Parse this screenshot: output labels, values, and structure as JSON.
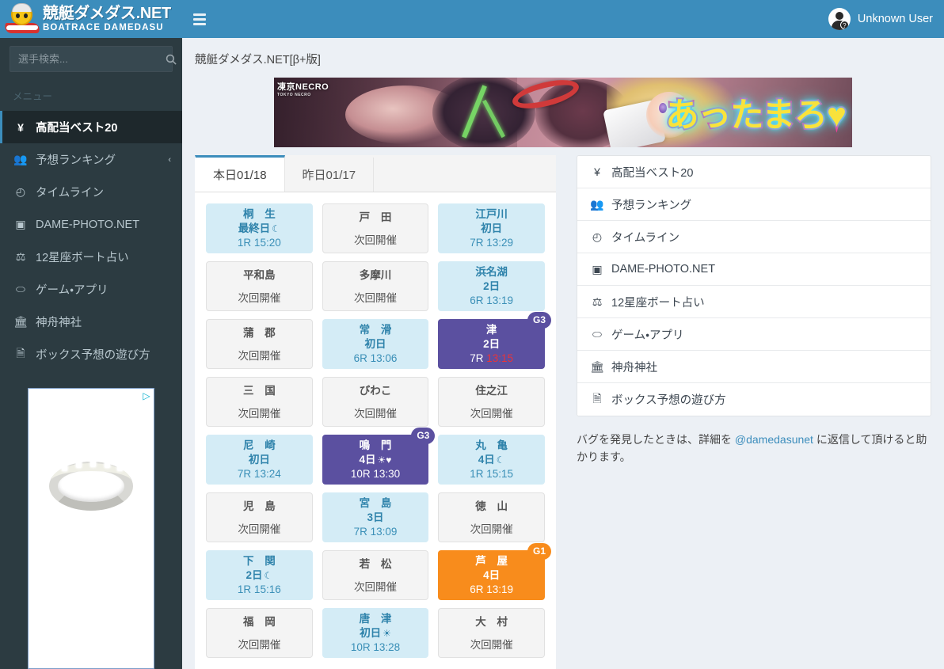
{
  "brand": {
    "title": "競艇ダメダス.NET",
    "subtitle": "BOATRACE DAMEDASU"
  },
  "search": {
    "placeholder": "選手検索...",
    "value": "",
    "icon": "search-icon"
  },
  "sidebar": {
    "menu_header": "メニュー",
    "items": [
      {
        "label": "高配当ベスト20",
        "icon": "¥",
        "icon_name": "yen-icon",
        "active": true,
        "caret": ""
      },
      {
        "label": "予想ランキング",
        "icon": "👥",
        "icon_name": "users-icon",
        "active": false,
        "caret": "‹"
      },
      {
        "label": "タイムライン",
        "icon": "◴",
        "icon_name": "clock-icon",
        "active": false,
        "caret": ""
      },
      {
        "label": "DAME-PHOTO.NET",
        "icon": "▣",
        "icon_name": "camera-icon",
        "active": false,
        "caret": ""
      },
      {
        "label": "12星座ボート占い",
        "icon": "⚖",
        "icon_name": "scales-icon",
        "active": false,
        "caret": ""
      },
      {
        "label": "ゲーム・アプリ",
        "icon": "⬭",
        "icon_name": "gamepad-icon",
        "active": false,
        "caret": ""
      },
      {
        "label": "神舟神社",
        "icon": "🏛",
        "icon_name": "bank-icon",
        "active": false,
        "caret": ""
      },
      {
        "label": "ボックス予想の遊び方",
        "icon": "🗎",
        "icon_name": "document-icon",
        "active": false,
        "caret": ""
      }
    ]
  },
  "ad": {
    "label": "▷",
    "alt": "diamond-ring-advertisement"
  },
  "topbar": {
    "menu_toggle": "hamburger-icon",
    "user_name": "Unknown User"
  },
  "page": {
    "title": "競艇ダメダス.NET[β+版]"
  },
  "banner": {
    "brand_logo": "凍京NECRO",
    "brand_sub": "TOKYO NECRO",
    "catch": "あったまろ♥"
  },
  "tabs": [
    {
      "label": "本日01/18",
      "active": true
    },
    {
      "label": "昨日01/17",
      "active": false
    }
  ],
  "races": [
    {
      "venue": "桐 生",
      "day": "最終日",
      "icon": "☾",
      "icon_name": "moon-icon",
      "race": "1R 15:20",
      "state": "lit",
      "grade": "",
      "time_red": false
    },
    {
      "venue": "戸 田",
      "day": "",
      "icon": "",
      "icon_name": "",
      "race": "次回開催",
      "state": "off",
      "grade": "",
      "time_red": false
    },
    {
      "venue": "江戸川",
      "day": "初日",
      "icon": "",
      "icon_name": "",
      "race": "7R 13:29",
      "state": "lit",
      "grade": "",
      "time_red": false
    },
    {
      "venue": "平和島",
      "day": "",
      "icon": "",
      "icon_name": "",
      "race": "次回開催",
      "state": "off",
      "grade": "",
      "time_red": false
    },
    {
      "venue": "多摩川",
      "day": "",
      "icon": "",
      "icon_name": "",
      "race": "次回開催",
      "state": "off",
      "grade": "",
      "time_red": false
    },
    {
      "venue": "浜名湖",
      "day": "2日",
      "icon": "",
      "icon_name": "",
      "race": "6R 13:19",
      "state": "lit",
      "grade": "",
      "time_red": false
    },
    {
      "venue": "蒲 郡",
      "day": "",
      "icon": "",
      "icon_name": "",
      "race": "次回開催",
      "state": "off",
      "grade": "",
      "time_red": false
    },
    {
      "venue": "常 滑",
      "day": "初日",
      "icon": "",
      "icon_name": "",
      "race": "6R 13:06",
      "state": "lit",
      "grade": "",
      "time_red": false
    },
    {
      "venue": "津",
      "day": "2日",
      "icon": "",
      "icon_name": "",
      "race": "7R",
      "race_time": "13:15",
      "state": "g3",
      "grade": "G3",
      "time_red": true
    },
    {
      "venue": "三 国",
      "day": "",
      "icon": "",
      "icon_name": "",
      "race": "次回開催",
      "state": "off",
      "grade": "",
      "time_red": false
    },
    {
      "venue": "びわこ",
      "day": "",
      "icon": "",
      "icon_name": "",
      "race": "次回開催",
      "state": "off",
      "grade": "",
      "time_red": false
    },
    {
      "venue": "住之江",
      "day": "",
      "icon": "",
      "icon_name": "",
      "race": "次回開催",
      "state": "off",
      "grade": "",
      "time_red": false
    },
    {
      "venue": "尼 崎",
      "day": "初日",
      "icon": "",
      "icon_name": "",
      "race": "7R 13:24",
      "state": "lit",
      "grade": "",
      "time_red": false
    },
    {
      "venue": "鳴 門",
      "day": "4日",
      "icon": "☀♥",
      "icon_name": "sun-heart-icon",
      "race": "10R 13:30",
      "state": "g3",
      "grade": "G3",
      "time_red": false
    },
    {
      "venue": "丸 亀",
      "day": "4日",
      "icon": "☾",
      "icon_name": "moon-icon",
      "race": "1R 15:15",
      "state": "lit",
      "grade": "",
      "time_red": false
    },
    {
      "venue": "児 島",
      "day": "",
      "icon": "",
      "icon_name": "",
      "race": "次回開催",
      "state": "off",
      "grade": "",
      "time_red": false
    },
    {
      "venue": "宮 島",
      "day": "3日",
      "icon": "",
      "icon_name": "",
      "race": "7R 13:09",
      "state": "lit",
      "grade": "",
      "time_red": false
    },
    {
      "venue": "徳 山",
      "day": "",
      "icon": "",
      "icon_name": "",
      "race": "次回開催",
      "state": "off",
      "grade": "",
      "time_red": false
    },
    {
      "venue": "下 関",
      "day": "2日",
      "icon": "☾",
      "icon_name": "moon-icon",
      "race": "1R 15:16",
      "state": "lit",
      "grade": "",
      "time_red": false
    },
    {
      "venue": "若 松",
      "day": "",
      "icon": "",
      "icon_name": "",
      "race": "次回開催",
      "state": "off",
      "grade": "",
      "time_red": false
    },
    {
      "venue": "芦 屋",
      "day": "4日",
      "icon": "",
      "icon_name": "",
      "race": "6R 13:19",
      "state": "g1",
      "grade": "G1",
      "time_red": false
    },
    {
      "venue": "福 岡",
      "day": "",
      "icon": "",
      "icon_name": "",
      "race": "次回開催",
      "state": "off",
      "grade": "",
      "time_red": false
    },
    {
      "venue": "唐 津",
      "day": "初日",
      "icon": "☀",
      "icon_name": "sun-icon",
      "race": "10R 13:28",
      "state": "lit",
      "grade": "",
      "time_red": false
    },
    {
      "venue": "大 村",
      "day": "",
      "icon": "",
      "icon_name": "",
      "race": "次回開催",
      "state": "off",
      "grade": "",
      "time_red": false
    }
  ],
  "right_menu": [
    {
      "label": "高配当ベスト20",
      "icon": "¥",
      "icon_name": "yen-icon"
    },
    {
      "label": "予想ランキング",
      "icon": "👥",
      "icon_name": "users-icon"
    },
    {
      "label": "タイムライン",
      "icon": "◴",
      "icon_name": "clock-icon"
    },
    {
      "label": "DAME-PHOTO.NET",
      "icon": "▣",
      "icon_name": "camera-icon"
    },
    {
      "label": "12星座ボート占い",
      "icon": "⚖",
      "icon_name": "scales-icon"
    },
    {
      "label": "ゲーム・アプリ",
      "icon": "⬭",
      "icon_name": "gamepad-icon"
    },
    {
      "label": "神舟神社",
      "icon": "🏛",
      "icon_name": "bank-icon"
    },
    {
      "label": "ボックス予想の遊び方",
      "icon": "🗎",
      "icon_name": "document-icon"
    }
  ],
  "note": {
    "before": "バグを発見したときは、詳細を ",
    "link": "@damedasunet",
    "after": " に返信して頂けると助かります。"
  },
  "colors": {
    "brand_blue": "#3c8dbc",
    "sidebar_dark": "#2c3b41",
    "sidebar_active": "#1e282c",
    "card_lit": "#d4ecf6",
    "card_off": "#f4f4f4",
    "g3_purple": "#5b50a0",
    "g1_orange": "#f88c1c",
    "time_red": "#e8343a",
    "page_bg": "#ecf0f5"
  }
}
